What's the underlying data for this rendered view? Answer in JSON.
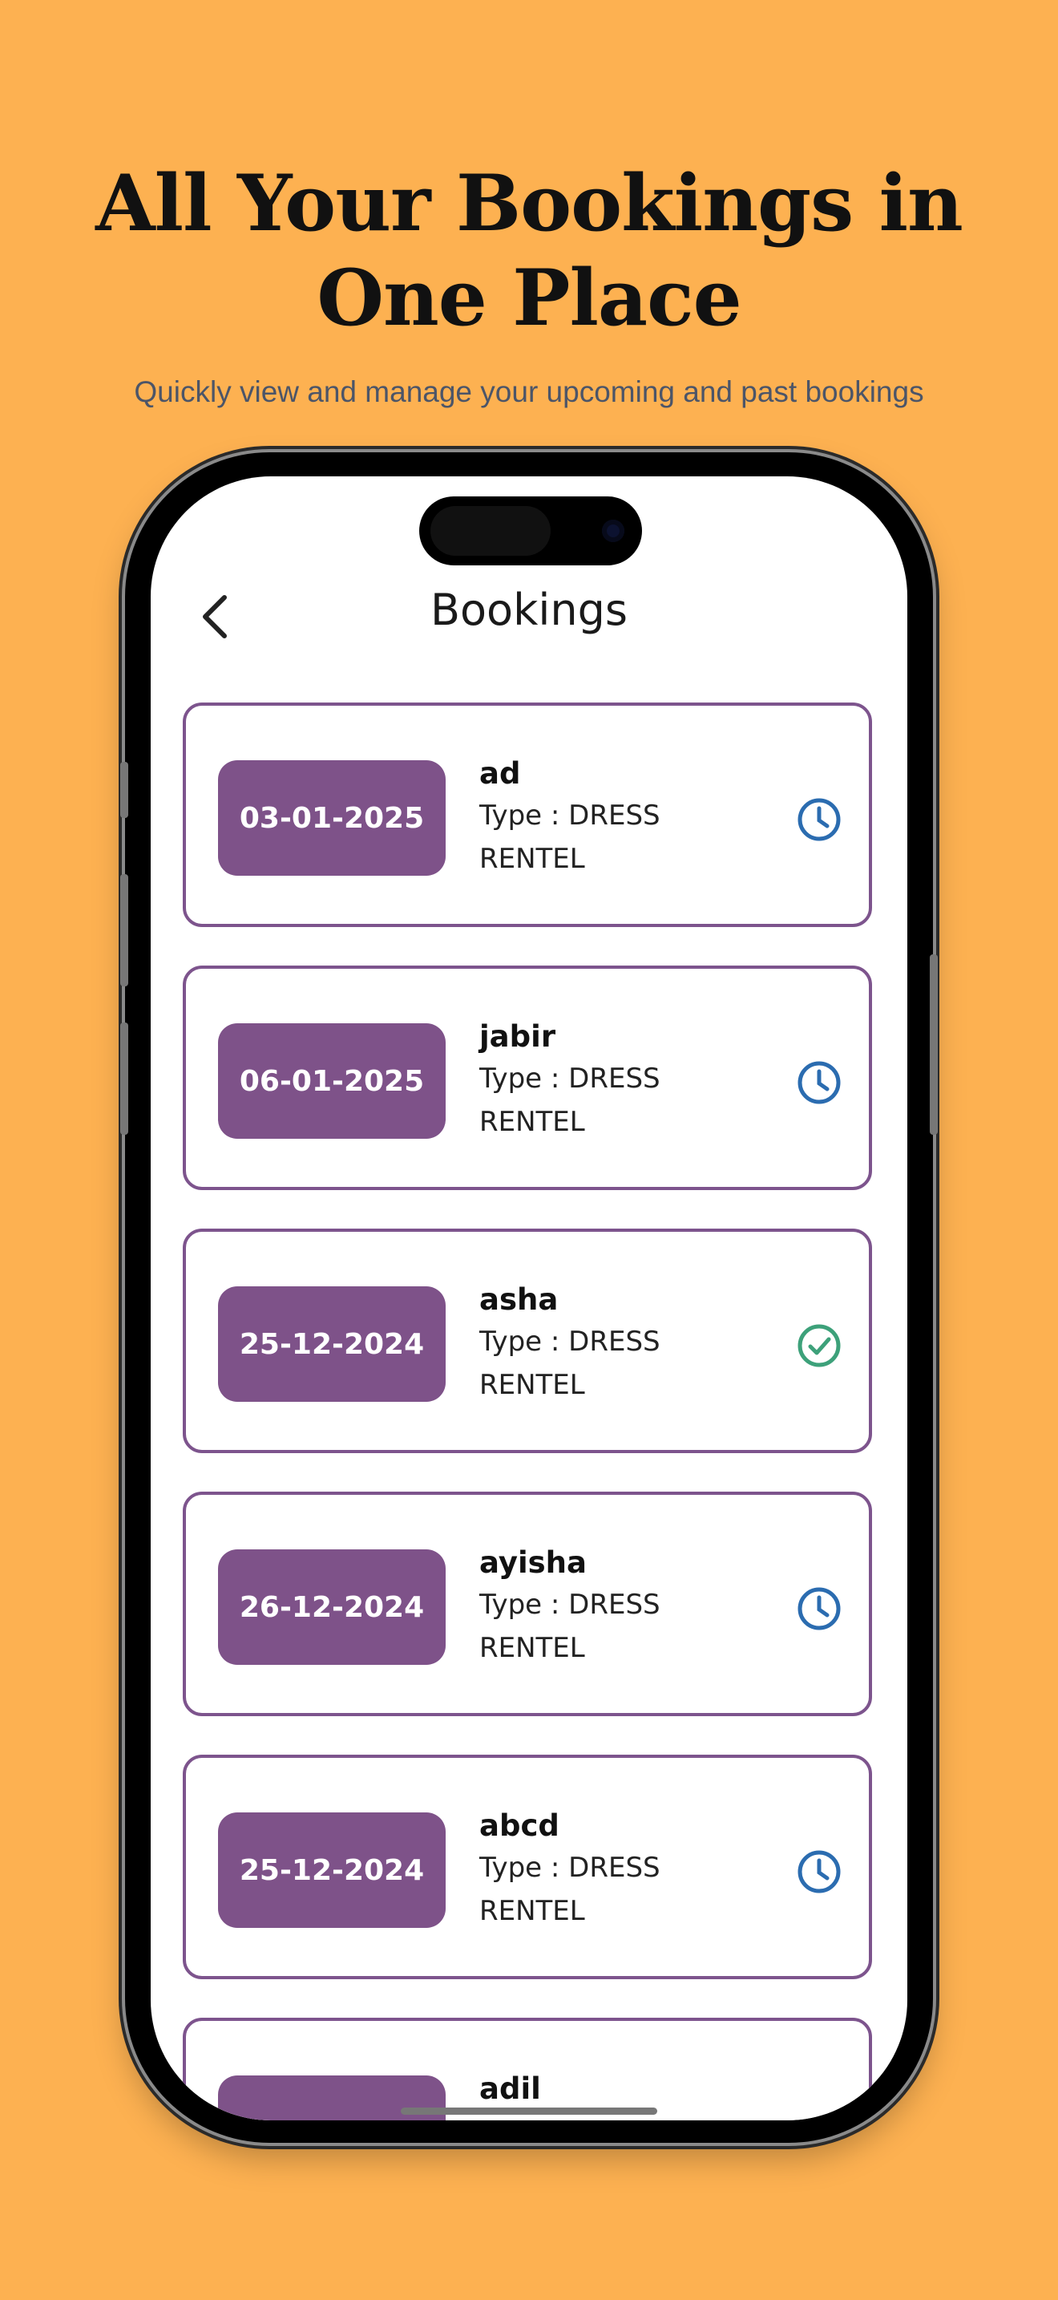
{
  "headline": "All Your Bookings in One Place",
  "subheadline": "Quickly view and manage your upcoming and past bookings",
  "screen": {
    "title": "Bookings",
    "back_icon": "chevron-left-icon"
  },
  "colors": {
    "background": "#FDB151",
    "accent_purple": "#7E5289",
    "pending_blue": "#2B6CB0",
    "completed_green": "#3DA17A"
  },
  "bookings": [
    {
      "date": "03-01-2025",
      "name": "ad",
      "type": "Type : DRESS RENTEL",
      "status": "pending",
      "status_icon": "clock-icon"
    },
    {
      "date": "06-01-2025",
      "name": "jabir",
      "type": "Type : DRESS RENTEL",
      "status": "pending",
      "status_icon": "clock-icon"
    },
    {
      "date": "25-12-2024",
      "name": "asha",
      "type": "Type : DRESS RENTEL",
      "status": "completed",
      "status_icon": "check-circle-icon"
    },
    {
      "date": "26-12-2024",
      "name": "ayisha",
      "type": "Type : DRESS RENTEL",
      "status": "pending",
      "status_icon": "clock-icon"
    },
    {
      "date": "25-12-2024",
      "name": "abcd",
      "type": "Type : DRESS RENTEL",
      "status": "pending",
      "status_icon": "clock-icon"
    },
    {
      "date": "",
      "name": "adil",
      "type": "",
      "status": "",
      "status_icon": ""
    }
  ]
}
